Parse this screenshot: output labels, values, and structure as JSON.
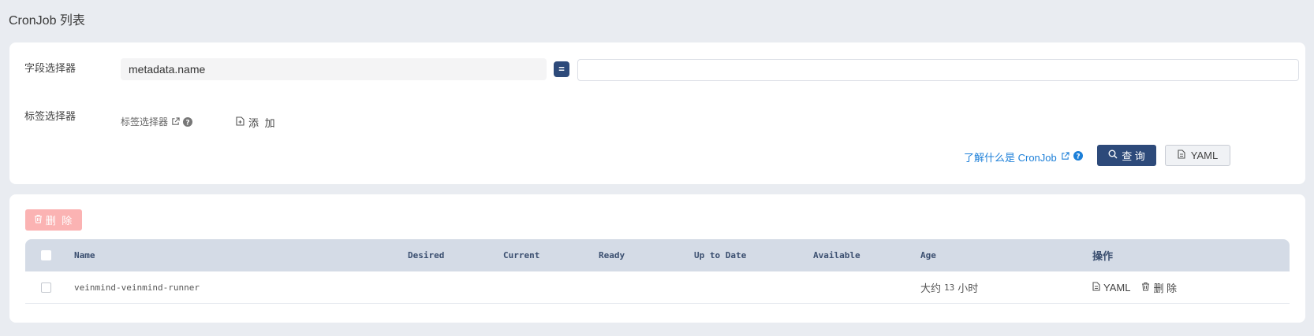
{
  "page": {
    "title": "CronJob 列表"
  },
  "filter": {
    "field_selector_label": "字段选择器",
    "field_value": "metadata.name",
    "operator": "=",
    "input_value": "",
    "label_selector_label": "标签选择器",
    "label_selector_hint": "标签选择器",
    "add_label": "添 加",
    "learn_link": "了解什么是 CronJob",
    "query_label": "查 询",
    "yaml_label": "YAML"
  },
  "table": {
    "delete_label": "删 除",
    "columns": [
      "Name",
      "Desired",
      "Current",
      "Ready",
      "Up to Date",
      "Available",
      "Age",
      "操作"
    ],
    "rows": [
      {
        "name": "veinmind-veinmind-runner",
        "desired": "",
        "current": "",
        "ready": "",
        "up_to_date": "",
        "available": "",
        "age_prefix": "大约",
        "age_num": "13",
        "age_unit": "小时",
        "op_yaml": "YAML",
        "op_delete": "删 除"
      }
    ]
  },
  "colors": {
    "primary": "#2d4a7a",
    "link": "#1c7fd8",
    "danger_disabled": "#fbb3b3",
    "header_bg": "#d4dbe6"
  }
}
